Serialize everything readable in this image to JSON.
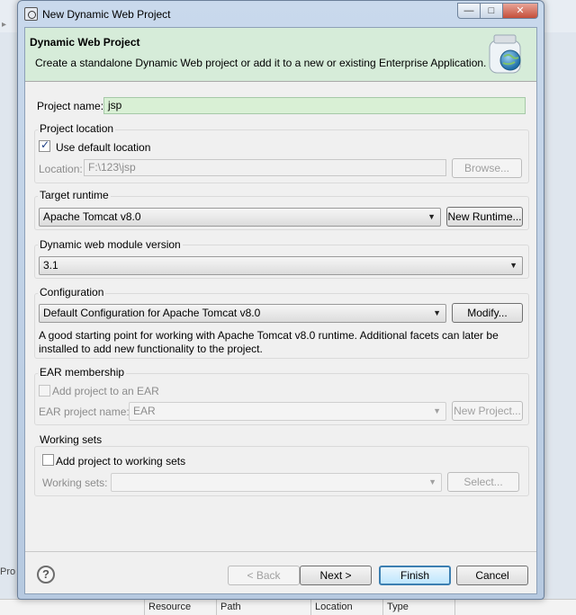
{
  "window": {
    "title": "New Dynamic Web Project",
    "minimize_glyph": "—",
    "maximize_glyph": "□",
    "close_glyph": "✕"
  },
  "banner": {
    "title": "Dynamic Web Project",
    "description": "Create a standalone Dynamic Web project or add it to a new or existing Enterprise Application."
  },
  "project_name": {
    "label": "Project name:",
    "value": "jsp"
  },
  "project_location": {
    "group_title": "Project location",
    "use_default_label": "Use default location",
    "use_default_checked": true,
    "location_label": "Location:",
    "location_value": "F:\\123\\jsp",
    "browse_label": "Browse..."
  },
  "target_runtime": {
    "group_title": "Target runtime",
    "selected": "Apache Tomcat v8.0",
    "new_runtime_label": "New Runtime..."
  },
  "module_version": {
    "group_title": "Dynamic web module version",
    "selected": "3.1"
  },
  "configuration": {
    "group_title": "Configuration",
    "selected": "Default Configuration for Apache Tomcat v8.0",
    "modify_label": "Modify...",
    "description_line1": "A good starting point for working with Apache Tomcat v8.0 runtime. Additional facets can later be",
    "description_line2": "installed to add new functionality to the project."
  },
  "ear_membership": {
    "group_title": "EAR membership",
    "add_label": "Add project to an EAR",
    "ear_name_label": "EAR project name:",
    "ear_name_value": "EAR",
    "new_project_label": "New Project..."
  },
  "working_sets": {
    "group_title": "Working sets",
    "add_label": "Add project to working sets",
    "sets_label": "Working sets:",
    "sets_value": "",
    "select_label": "Select..."
  },
  "footer": {
    "help_glyph": "?",
    "back_label": "< Back",
    "next_label": "Next >",
    "finish_label": "Finish",
    "cancel_label": "Cancel"
  },
  "background": {
    "problems_tab": "Pro",
    "columns": [
      "Resource",
      "Path",
      "Location",
      "Type"
    ]
  },
  "colors": {
    "banner_bg": "#d6ecd9",
    "input_bg": "#d9f0d5",
    "default_button_border": "#3c7fb1"
  }
}
